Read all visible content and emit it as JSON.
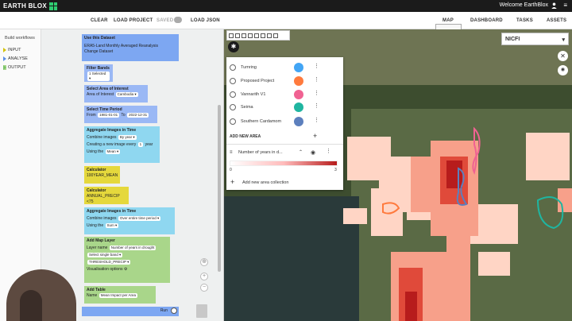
{
  "brand": {
    "name": "EARTH BLOX"
  },
  "header": {
    "welcome": "Welcome EarthBlox",
    "menu_glyph": "≡"
  },
  "toolbar": {
    "clear": "CLEAR",
    "load_project": "LOAD PROJECT",
    "saved": "SAVED",
    "load_json": "LOAD JSON"
  },
  "nav": {
    "map": "MAP",
    "dashboard": "DASHBOARD",
    "tasks": "TASKS",
    "assets": "ASSETS"
  },
  "sidebar": {
    "title": "Build workflows",
    "items": [
      {
        "label": "INPUT",
        "color": "#d4c20d"
      },
      {
        "label": "ANALYSE",
        "color": "#5b8ee6"
      },
      {
        "label": "OUTPUT",
        "color": "#7ac36a"
      }
    ]
  },
  "workflow": {
    "dataset": {
      "title": "Use this Dataset",
      "name": "ERA5-Land Monthly Averaged Reanalysis",
      "change": "Change Dataset"
    },
    "filter": {
      "title": "Filter Bands",
      "value": "1 Selected ▾"
    },
    "area": {
      "title": "Select Area of Interest",
      "label": "Area of Interest",
      "value": "Cambodia ▾"
    },
    "time": {
      "title": "Select Time Period",
      "from_label": "From",
      "from": "1981-01-01",
      "to_label": "To",
      "to": "2022-12-31"
    },
    "aggregate1": {
      "title": "Aggregate Images in Time",
      "combine_label": "Combine images",
      "combine": "By year ▾",
      "every_label": "Creating a new image every",
      "every_value": "1",
      "every_unit": "year",
      "using_label": "Using the",
      "using": "Mean ▾"
    },
    "calc1": {
      "title": "Calculator",
      "name": "100YEAR_MEAN"
    },
    "calc2": {
      "title": "Calculator",
      "name": "ANNUAL_PRECIP <75"
    },
    "aggregate2": {
      "title": "Aggregate Images in Time",
      "combine_label": "Combine images",
      "combine": "Over entire time period ▾",
      "using_label": "Using the",
      "using": "Sum ▾"
    },
    "maplayer": {
      "title": "Add Map Layer",
      "name_label": "Layer name",
      "name_value": "Number of years in drought",
      "band": "Select single band ▾",
      "threshold": "THRESHOLD_PRECIP ▾",
      "vis": "Visualisation options"
    },
    "table": {
      "title": "Add Table",
      "name_label": "Name",
      "name_value": "Mean Impact per Area"
    },
    "run": "Run"
  },
  "map": {
    "basemap": "NICFI",
    "close_glyph": "✕",
    "areas": [
      {
        "label": "Tumring",
        "color": "#42a5f5"
      },
      {
        "label": "Proposed Project",
        "color": "#ff7a3d"
      },
      {
        "label": "Vannarith V1",
        "color": "#f06292"
      },
      {
        "label": "Seima",
        "color": "#1fb5a0"
      },
      {
        "label": "Southern Cardamom",
        "color": "#5c7fbd"
      }
    ],
    "add_area": "ADD NEW AREA",
    "add_glyph": "+",
    "layer": {
      "name": "Number of years in d...",
      "min": "0",
      "max": "3",
      "ramp_start": "#ffffff",
      "ramp_end": "#b71c1c"
    },
    "add_collection": "Add new area collection"
  }
}
